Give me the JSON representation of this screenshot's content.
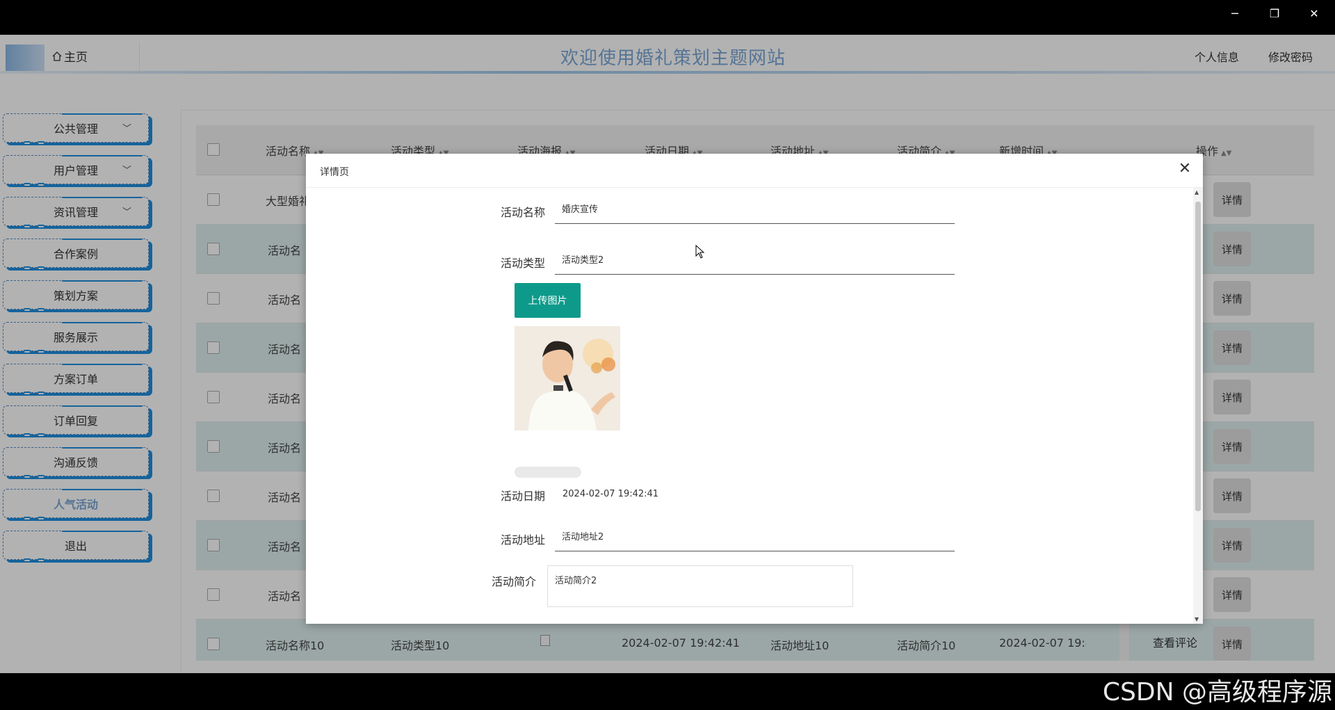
{
  "window": {
    "minimize": "─",
    "restore": "❐",
    "close": "✕"
  },
  "header": {
    "home_icon": "home-icon",
    "home": "主页",
    "title": "欢迎使用婚礼策划主题网站",
    "profile": "个人信息",
    "change_password": "修改密码"
  },
  "sidebar": {
    "items": [
      {
        "label": "公共管理",
        "expandable": true
      },
      {
        "label": "用户管理",
        "expandable": true
      },
      {
        "label": "资讯管理",
        "expandable": true
      },
      {
        "label": "合作案例"
      },
      {
        "label": "策划方案"
      },
      {
        "label": "服务展示"
      },
      {
        "label": "方案订单"
      },
      {
        "label": "订单回复"
      },
      {
        "label": "沟通反馈"
      },
      {
        "label": "人气活动",
        "active": true
      },
      {
        "label": "退出"
      }
    ]
  },
  "table": {
    "headers": [
      "活动名称",
      "活动类型",
      "活动海报",
      "活动日期",
      "活动地址",
      "活动简介",
      "新增时间",
      "操作"
    ],
    "rows": [
      {
        "name": "大型婚礼"
      },
      {
        "name": "活动名"
      },
      {
        "name": "活动名"
      },
      {
        "name": "活动名"
      },
      {
        "name": "活动名"
      },
      {
        "name": "活动名"
      },
      {
        "name": "活动名"
      },
      {
        "name": "活动名"
      },
      {
        "name": "活动名"
      },
      {
        "name": "活动名称10",
        "type": "活动类型10",
        "date": "2024-02-07 19:42:41",
        "address": "活动地址10",
        "intro": "活动简介10",
        "created": "2024-02-07 19:42:",
        "comment": "查看评论"
      }
    ],
    "detail_label": "详情"
  },
  "modal": {
    "title": "详情页",
    "close": "✕",
    "fields": {
      "name_label": "活动名称",
      "name_value": "婚庆宣传",
      "type_label": "活动类型",
      "type_value": "活动类型2",
      "upload": "上传图片",
      "date_label": "活动日期",
      "date_value": "2024-02-07 19:42:41",
      "address_label": "活动地址",
      "address_value": "活动地址2",
      "intro_label": "活动简介",
      "intro_value": "活动简介2"
    }
  },
  "watermark": "CSDN @高级程序源",
  "colors": {
    "accent": "#1e8fe0",
    "title": "#7aa7d6",
    "upload": "#0e9a8a",
    "row_alt": "#dff0ef"
  }
}
